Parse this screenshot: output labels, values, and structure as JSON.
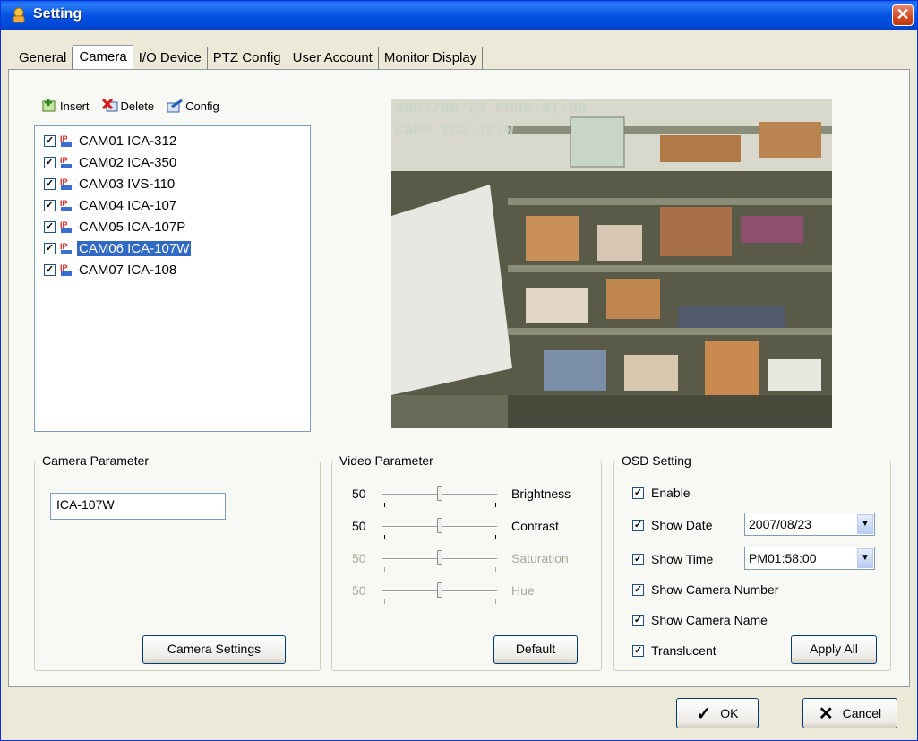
{
  "window": {
    "title": "Setting",
    "close_icon": "close-icon"
  },
  "tabs": [
    {
      "label": "General"
    },
    {
      "label": "Camera",
      "active": true
    },
    {
      "label": "I/O Device"
    },
    {
      "label": "PTZ Config"
    },
    {
      "label": "User Account"
    },
    {
      "label": "Monitor Display"
    }
  ],
  "toolbar": {
    "insert": "Insert",
    "delete": "Delete",
    "config": "Config"
  },
  "cameras": [
    {
      "label": "CAM01 ICA-312",
      "checked": true
    },
    {
      "label": "CAM02 ICA-350",
      "checked": true
    },
    {
      "label": "CAM03 IVS-110",
      "checked": true
    },
    {
      "label": "CAM04 ICA-107",
      "checked": true
    },
    {
      "label": "CAM05 ICA-107P",
      "checked": true
    },
    {
      "label": "CAM06 ICA-107W",
      "checked": true,
      "selected": true
    },
    {
      "label": "CAM07 ICA-108",
      "checked": true
    }
  ],
  "preview": {
    "osd_line1": "2007/08/23 PM02:01:00",
    "osd_line2": "CAM6 ICA-107W"
  },
  "camera_parameter": {
    "legend": "Camera Parameter",
    "name_value": "ICA-107W",
    "settings_button": "Camera Settings"
  },
  "video_parameter": {
    "legend": "Video Parameter",
    "brightness": {
      "value": "50",
      "label": "Brightness"
    },
    "contrast": {
      "value": "50",
      "label": "Contrast"
    },
    "saturation": {
      "value": "50",
      "label": "Saturation"
    },
    "hue": {
      "value": "50",
      "label": "Hue"
    },
    "default_button": "Default"
  },
  "osd_setting": {
    "legend": "OSD Setting",
    "enable": "Enable",
    "show_date": "Show Date",
    "date_value": "2007/08/23",
    "show_time": "Show Time",
    "time_value": "PM01:58:00",
    "show_camera_number": "Show Camera Number",
    "show_camera_name": "Show Camera Name",
    "translucent": "Translucent",
    "apply_all_button": "Apply All"
  },
  "dialog": {
    "ok": "OK",
    "cancel": "Cancel"
  },
  "colors": {
    "selection": "#316AC5",
    "titlebar": "#0453E3",
    "face": "#ECE9D8"
  }
}
